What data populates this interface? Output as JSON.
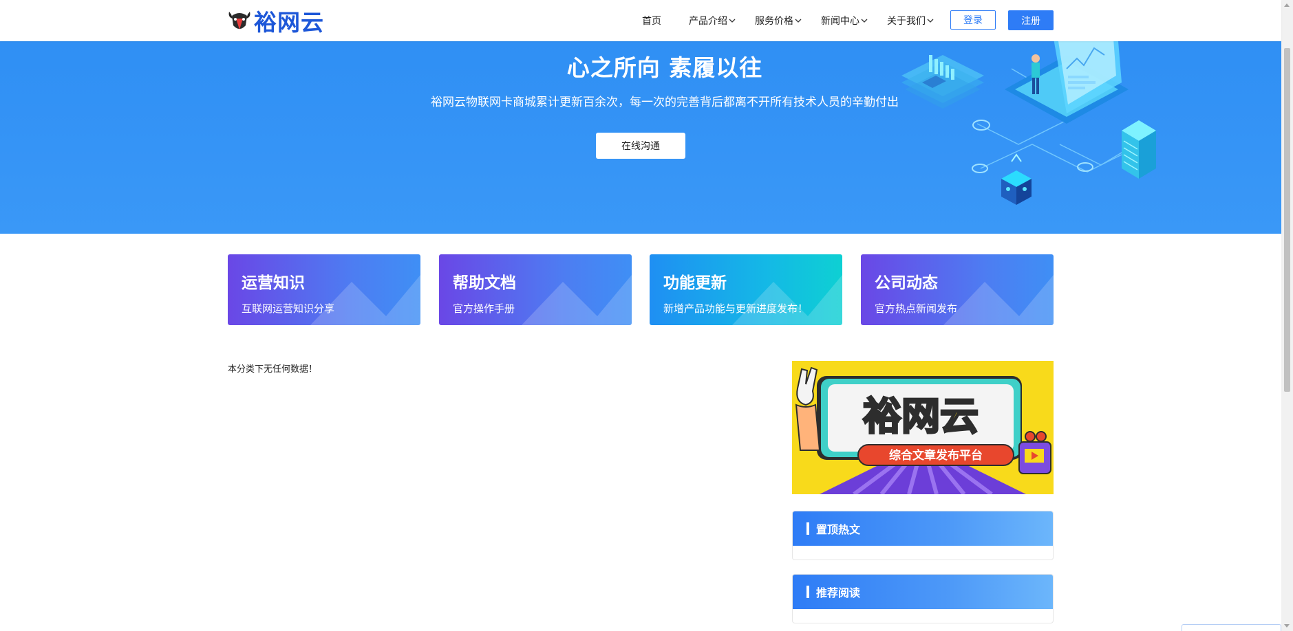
{
  "header": {
    "logo_text": "裕网云",
    "nav": [
      {
        "label": "首页",
        "has_dropdown": false
      },
      {
        "label": "产品介绍",
        "has_dropdown": true
      },
      {
        "label": "服务价格",
        "has_dropdown": true
      },
      {
        "label": "新闻中心",
        "has_dropdown": true
      },
      {
        "label": "关于我们",
        "has_dropdown": true
      }
    ],
    "login_label": "登录",
    "register_label": "注册"
  },
  "hero": {
    "title": "心之所向 素履以往",
    "subtitle": "裕网云物联网卡商城累计更新百余次，每一次的完善背后都离不开所有技术人员的辛勤付出",
    "button_label": "在线沟通"
  },
  "cards": [
    {
      "title": "运营知识",
      "subtitle": "互联网运营知识分享"
    },
    {
      "title": "帮助文档",
      "subtitle": "官方操作手册"
    },
    {
      "title": "功能更新",
      "subtitle": "新增产品功能与更新进度发布！"
    },
    {
      "title": "公司动态",
      "subtitle": "官方热点新闻发布"
    }
  ],
  "content": {
    "empty_message": "本分类下无任何数据！"
  },
  "banner": {
    "brand": "裕网云",
    "tagline": "综合文章发布平台"
  },
  "sidebar": {
    "panels": [
      {
        "title": "置顶热文"
      },
      {
        "title": "推荐阅读"
      }
    ]
  },
  "colors": {
    "accent": "#2e7cf6",
    "hero_bg": "#3393f5",
    "banner_bg": "#f8da1b",
    "card_purple": "#6a47e6",
    "card_cyan": "#0ed0d3"
  }
}
